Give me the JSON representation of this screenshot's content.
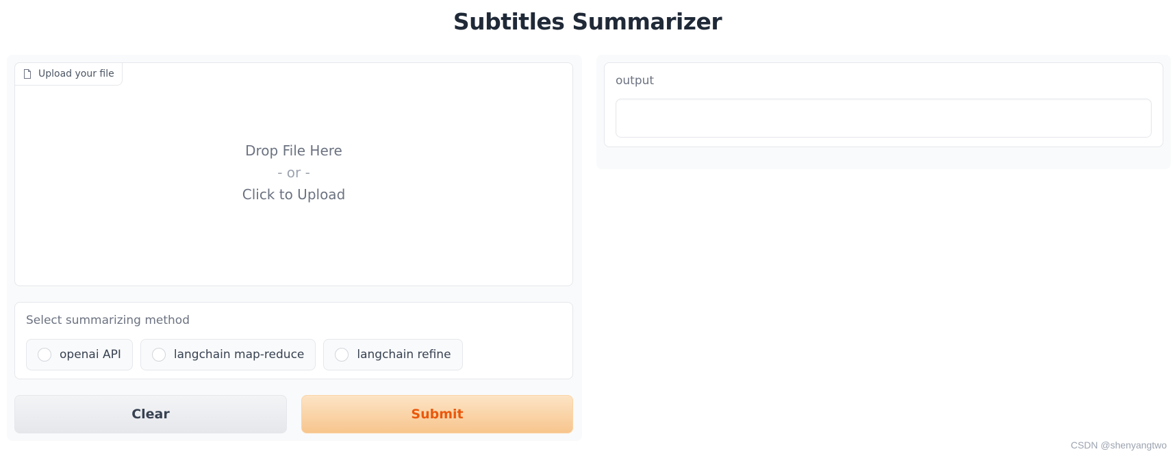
{
  "app": {
    "title": "Subtitles Summarizer"
  },
  "upload": {
    "label": "Upload your file",
    "icon": "file-icon",
    "drop_text": "Drop File Here",
    "or_text": "- or -",
    "click_text": "Click to Upload"
  },
  "method": {
    "label": "Select summarizing method",
    "options": [
      {
        "label": "openai API",
        "selected": false
      },
      {
        "label": "langchain map-reduce",
        "selected": false
      },
      {
        "label": "langchain refine",
        "selected": false
      }
    ]
  },
  "buttons": {
    "clear_label": "Clear",
    "submit_label": "Submit"
  },
  "output": {
    "label": "output",
    "value": ""
  },
  "watermark": "CSDN @shenyangtwo",
  "colors": {
    "accent": "#ea580c",
    "submit_bg_top": "#fde4c5",
    "submit_bg_bottom": "#f7c58d",
    "panel_bg": "#f9fafb",
    "border": "#e5e7eb"
  }
}
